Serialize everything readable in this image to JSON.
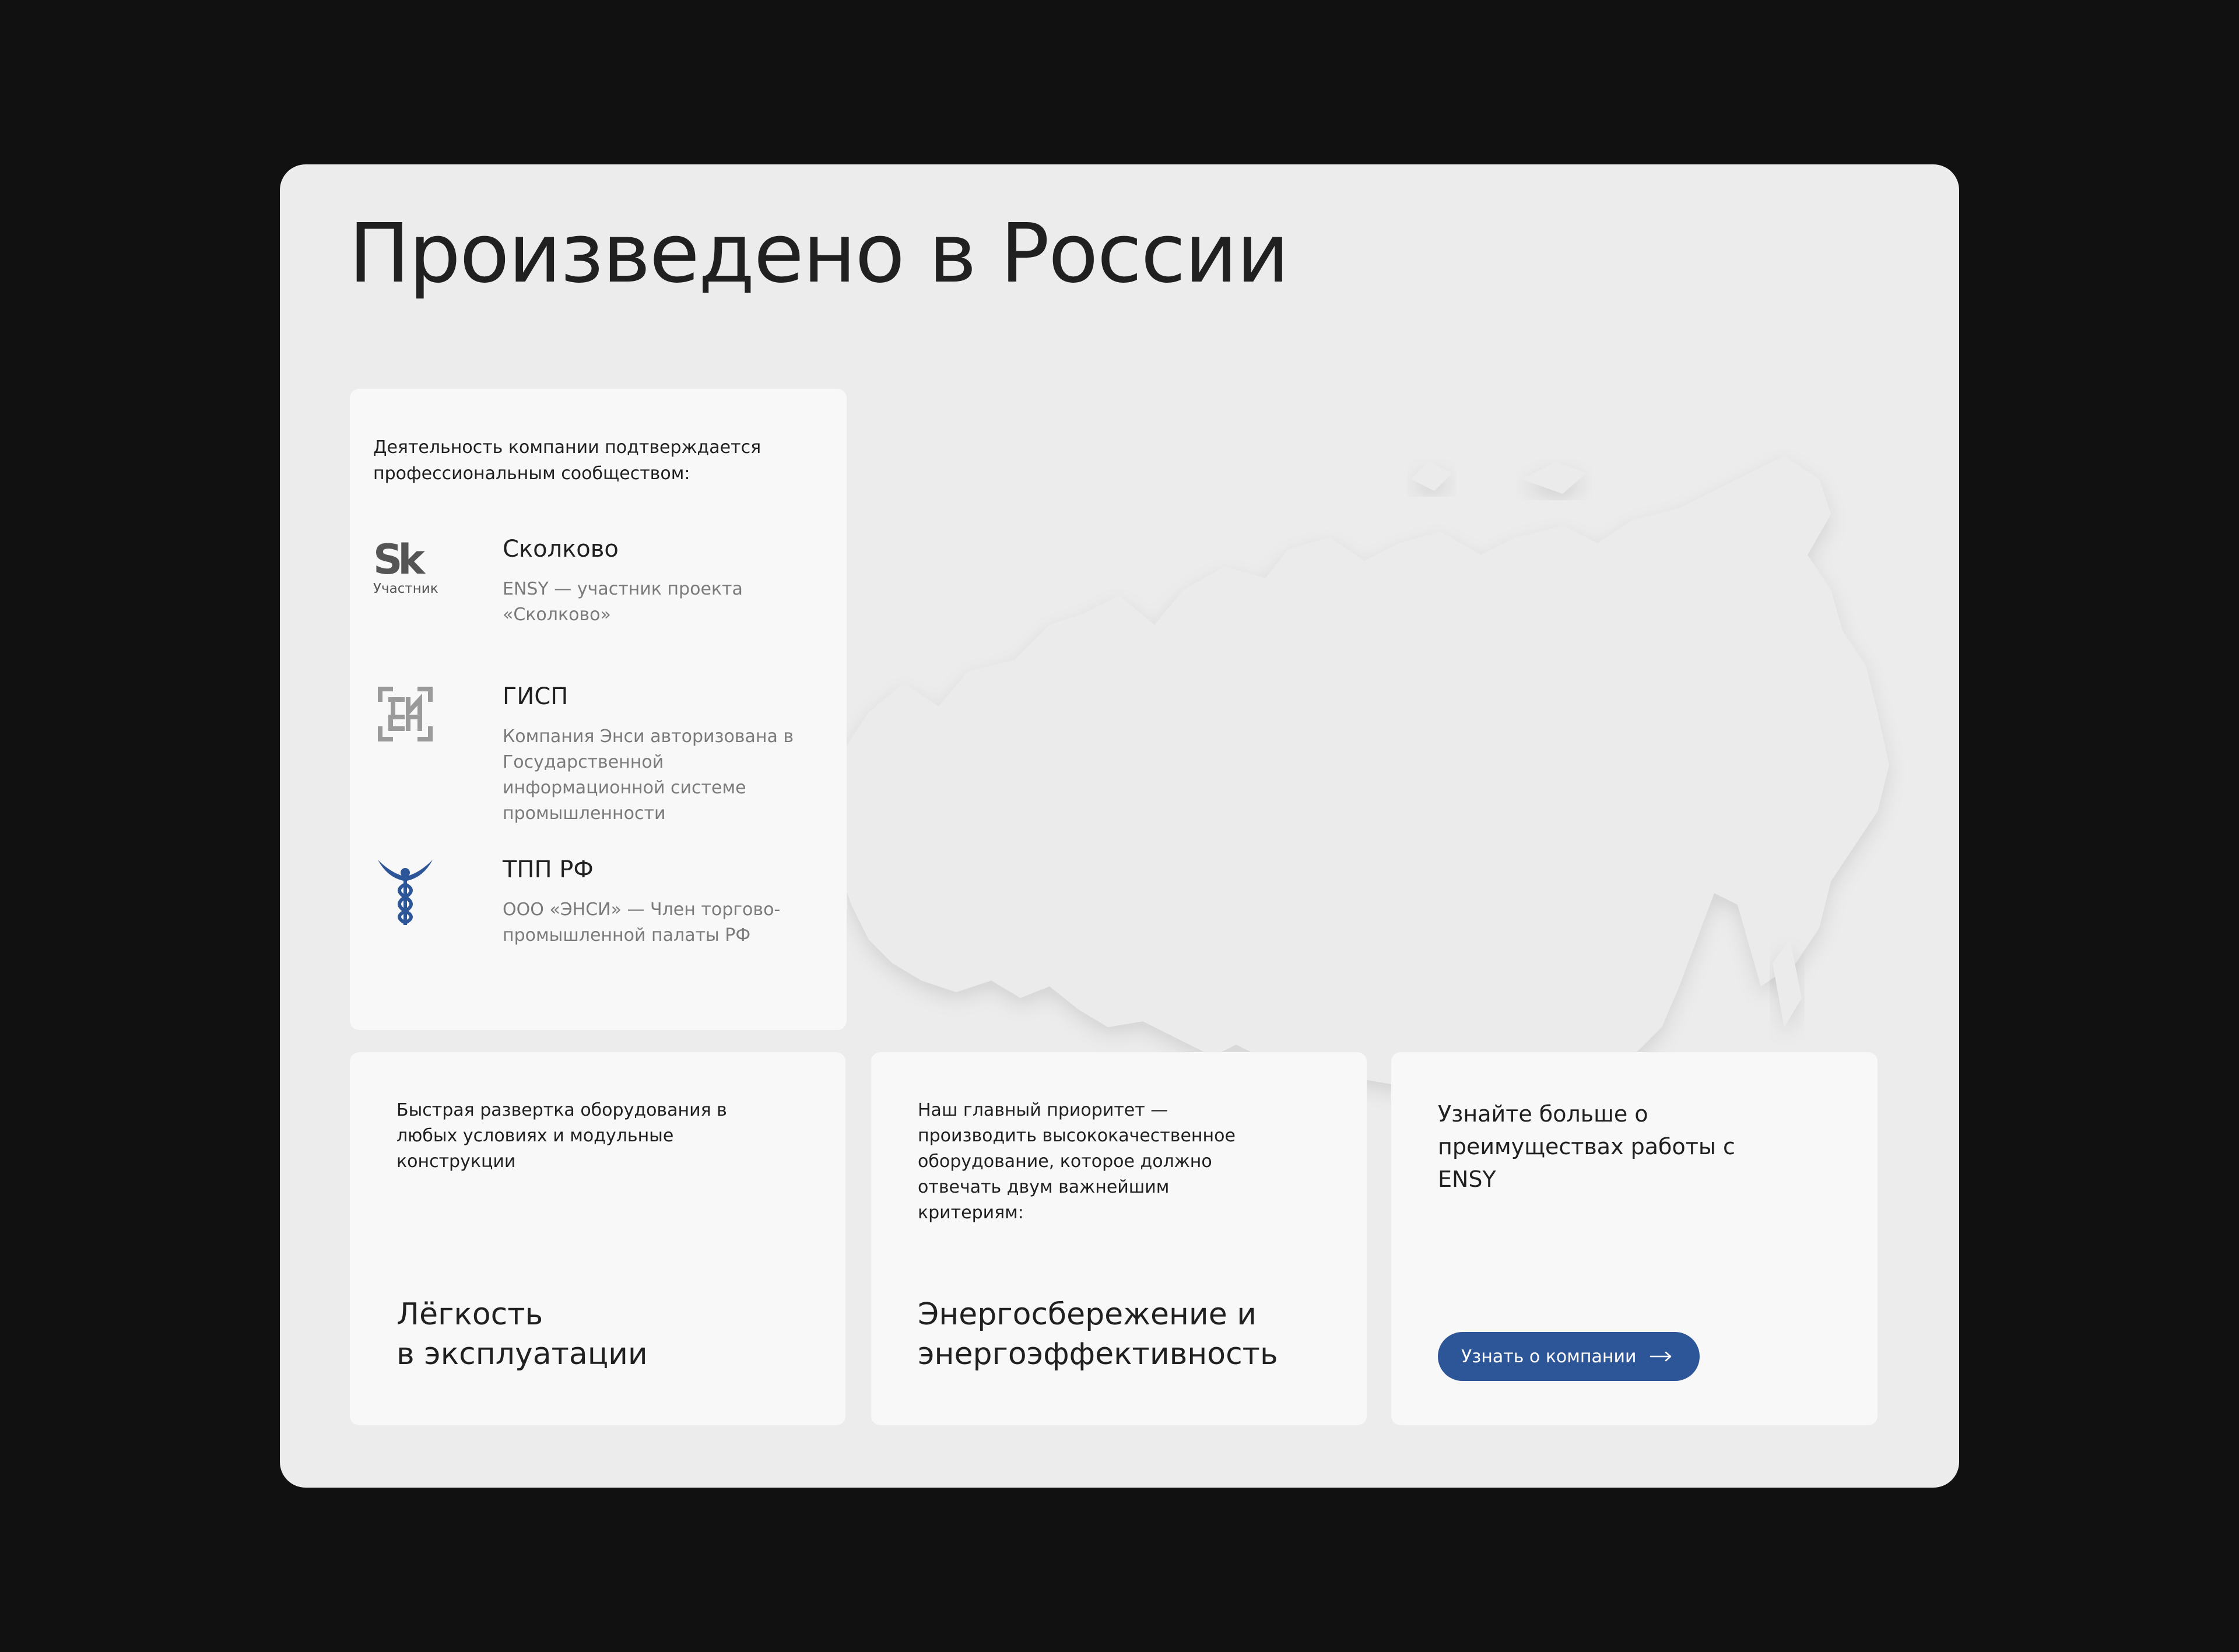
{
  "page": {
    "title": "Произведено в России"
  },
  "certifications": {
    "intro": "Деятельность компании подтверждается профессиональным сообществом:",
    "items": [
      {
        "name": "Сколково",
        "description": "ENSY — участник проекта «Сколково»",
        "logo_mark": "Sk",
        "logo_sub": "Участник",
        "icon": "skolkovo-logo"
      },
      {
        "name": "ГИСП",
        "description": "Компания Энси авторизована в Государственной информационной системе промышленности",
        "logo_mark": "ГИСП",
        "icon": "gisp-logo"
      },
      {
        "name": "ТПП РФ",
        "description": "ООО «ЭНСИ» — Член торгово-промышленной палаты РФ",
        "icon": "tpp-caduceus-logo"
      }
    ]
  },
  "features": [
    {
      "description": "Быстрая развертка оборудования в любых условиях и модульные конструкции",
      "title": "Лёгкость\nв эксплуатации"
    },
    {
      "description": "Наш главный приоритет — производить высококачественное оборудование, которое должно отвечать двум важнейшим критериям:",
      "title": "Энергосбережение и\nэнергоэффективность"
    }
  ],
  "cta": {
    "text": "Узнайте больше о преимуществах работы с ENSY",
    "button_label": "Узнать о компании",
    "button_icon": "arrow-right-icon"
  },
  "colors": {
    "page_background": "#111111",
    "panel_background": "#ececec",
    "card_background": "#f8f8f8",
    "accent": "#2d5698",
    "text_primary": "#202020",
    "text_secondary": "#7a7a7a"
  }
}
